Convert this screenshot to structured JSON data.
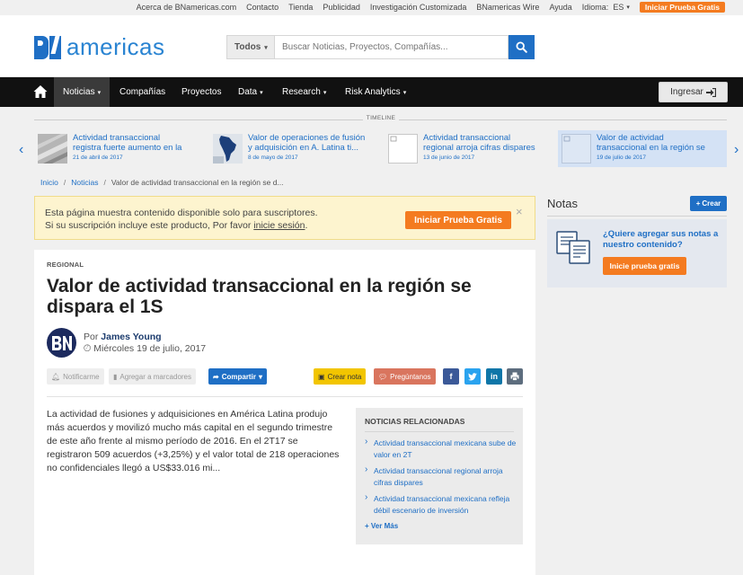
{
  "topbar": {
    "links": [
      "Acerca de BNamericas.com",
      "Contacto",
      "Tienda",
      "Publicidad",
      "Investigación Customizada",
      "BNamericas Wire",
      "Ayuda"
    ],
    "language_label": "Idioma:",
    "language_value": "ES",
    "trial_label": "Iniciar Prueba Gratis"
  },
  "header": {
    "logo_text": "americas",
    "search": {
      "category": "Todos",
      "placeholder": "Buscar Noticias, Proyectos, Compañías..."
    }
  },
  "nav": {
    "items": [
      "Noticias",
      "Compañías",
      "Proyectos",
      "Data",
      "Research",
      "Risk Analytics"
    ],
    "active": "Noticias",
    "login_label": "Ingresar"
  },
  "timeline": {
    "label": "TIMELINE",
    "items": [
      {
        "title_line1": "Actividad transaccional",
        "title_line2": "registra fuerte aumento en la",
        "date": "21 de abril de 2017"
      },
      {
        "title_line1": "Valor de operaciones de fusión",
        "title_line2": "y adquisición en A. Latina ti...",
        "date": "8 de mayo de 2017"
      },
      {
        "title_line1": "Actividad transaccional",
        "title_line2": "regional arroja cifras dispares",
        "date": "13 de junio de 2017"
      },
      {
        "title_line1": "Valor de actividad",
        "title_line2": "transaccional en la región se",
        "date": "19 de julio de 2017"
      }
    ]
  },
  "breadcrumb": {
    "home": "Inicio",
    "section": "Noticias",
    "current": "Valor de actividad transaccional en la región se d..."
  },
  "alert": {
    "line1": "Esta página muestra contenido disponible solo para suscriptores.",
    "line2_prefix": "Si su suscripción incluye este producto, Por favor ",
    "line2_link": "inicie sesión",
    "line2_suffix": ".",
    "trial_label": "Iniciar Prueba Gratis",
    "close": "×"
  },
  "article": {
    "category": "REGIONAL",
    "headline": "Valor de actividad transaccional en la región se dispara el 1S",
    "by_prefix": "Por",
    "author": "James Young",
    "date": "Miércoles 19 de julio, 2017",
    "actions": {
      "notify": "Notificarme",
      "bookmark": "Agregar a marcadores",
      "share": "Compartir",
      "note": "Crear nota",
      "ask": "Pregúntanos"
    },
    "body": "La actividad de fusiones y adquisiciones en América Latina produjo más acuerdos y movilizó mucho más capital en el segundo trimestre de este año frente al mismo período de 2016. En el 2T17 se registraron 509 acuerdos (+3,25%) y el valor total de 218 operaciones no confidenciales llegó a US$33.016 mi..."
  },
  "related": {
    "title": "NOTICIAS RELACIONADAS",
    "items": [
      "Actividad transaccional mexicana sube de valor en 2T",
      "Actividad transaccional regional arroja cifras dispares",
      "Actividad transaccional mexicana refleja débil escenario de inversión"
    ],
    "more": "Ver Más"
  },
  "notes": {
    "title": "Notas",
    "create": "Crear",
    "question": "¿Quiere agregar sus notas a nuestro contenido?",
    "cta": "Inicie prueba gratis"
  },
  "colors": {
    "brand_blue": "#1f6fc5",
    "accent_orange": "#f47b20",
    "nav_black": "#111111"
  }
}
